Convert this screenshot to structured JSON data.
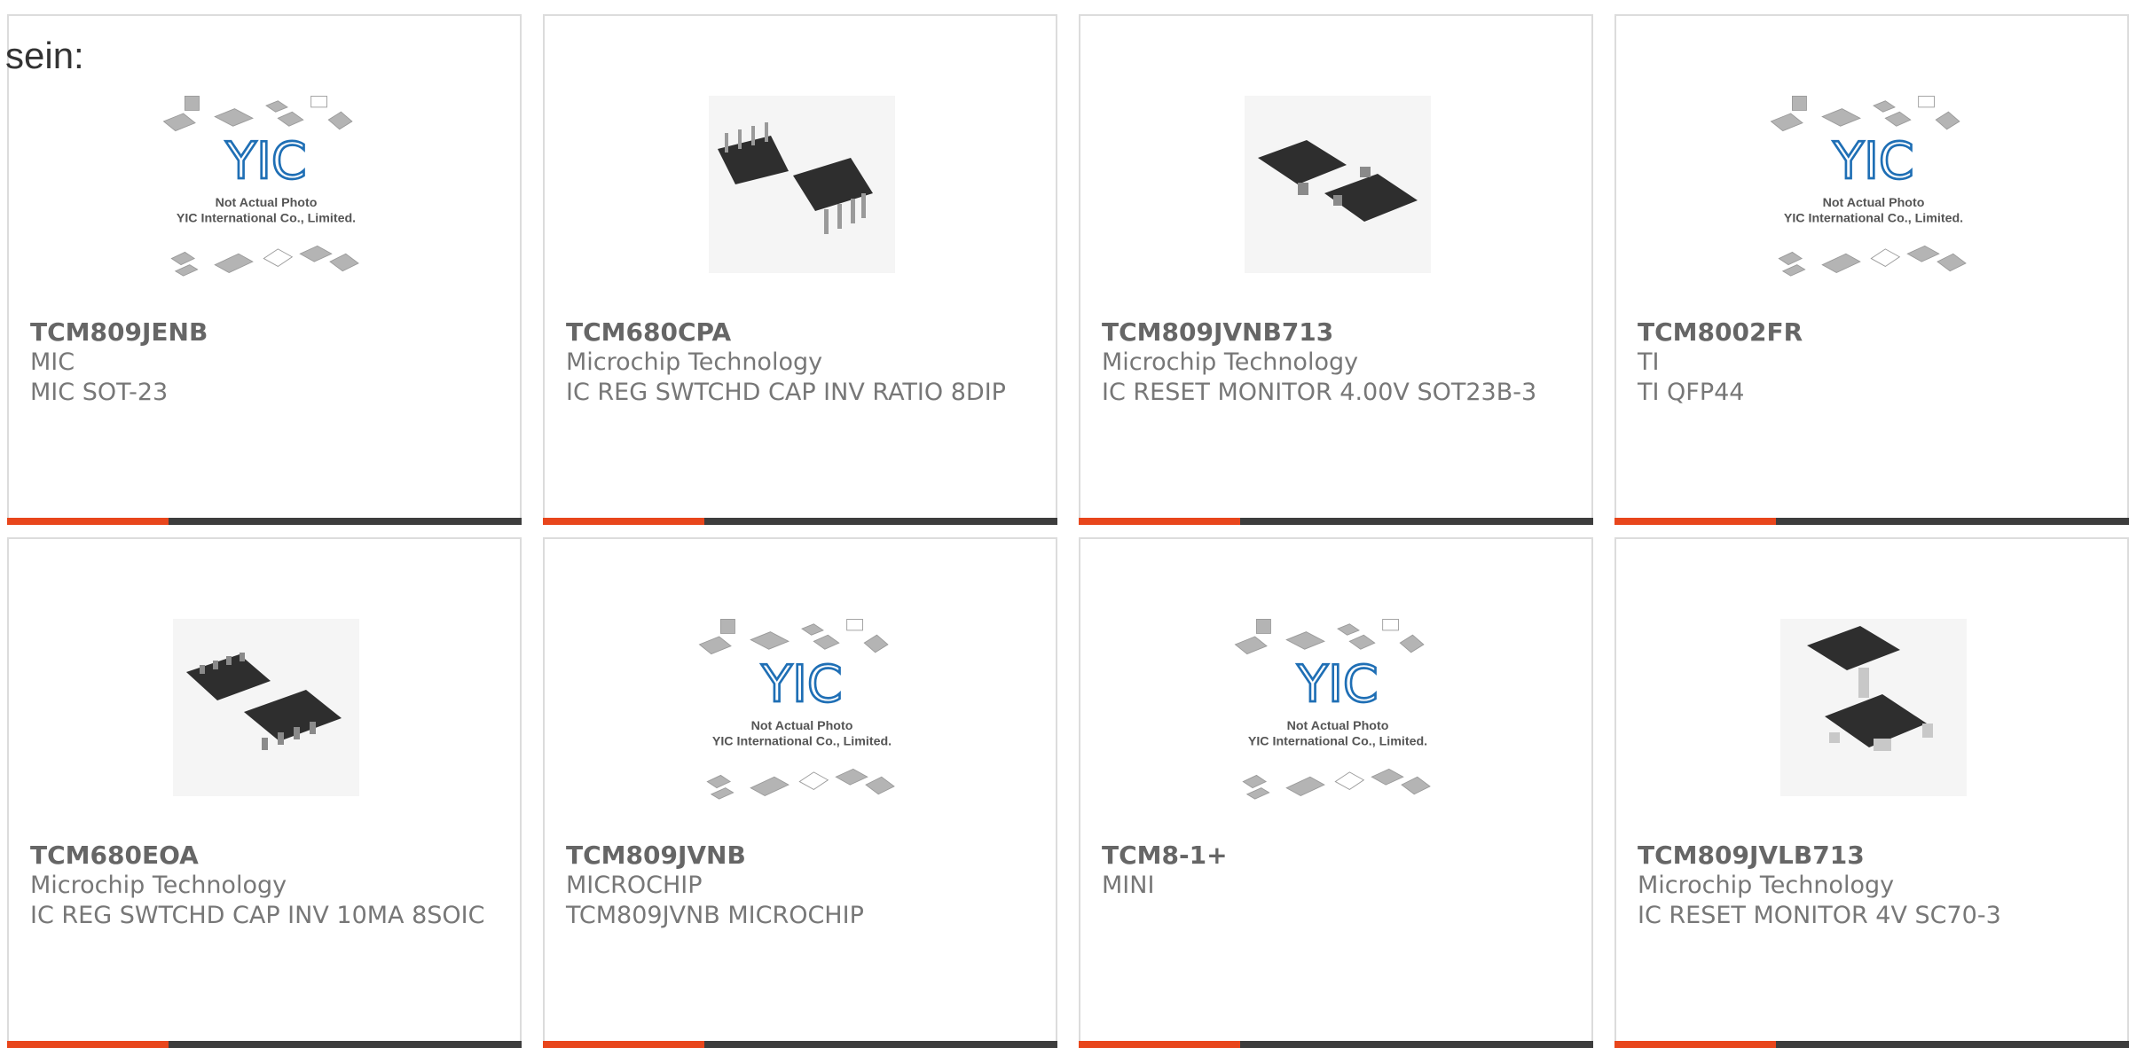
{
  "intro_text": "sein:",
  "placeholder": {
    "logo": "YIC",
    "caption_line1": "Not Actual Photo",
    "caption_line2": "YIC International Co., Limited."
  },
  "colors": {
    "accent": "#e8461c",
    "bar": "#3d3d3d",
    "border": "#dcdcdc",
    "logo_blue": "#1f6fb5"
  },
  "products": [
    {
      "pn": "TCM809JENB",
      "mfr": "MIC",
      "desc": "MIC SOT-23",
      "image": "not-actual-photo"
    },
    {
      "pn": "TCM680CPA",
      "mfr": "Microchip Technology",
      "desc": "IC REG SWTCHD CAP INV RATIO 8DIP",
      "image": "dip8-photo"
    },
    {
      "pn": "TCM809JVNB713",
      "mfr": "Microchip Technology",
      "desc": "IC RESET MONITOR 4.00V SOT23B-3",
      "image": "sot23-photo"
    },
    {
      "pn": "TCM8002FR",
      "mfr": "TI",
      "desc": "TI QFP44",
      "image": "not-actual-photo"
    },
    {
      "pn": "TCM680EOA",
      "mfr": "Microchip Technology",
      "desc": "IC REG SWTCHD CAP INV 10MA 8SOIC",
      "image": "soic8-photo"
    },
    {
      "pn": "TCM809JVNB",
      "mfr": "MICROCHIP",
      "desc": "TCM809JVNB MICROCHIP",
      "image": "not-actual-photo"
    },
    {
      "pn": "TCM8-1+",
      "mfr": "MINI",
      "desc": "",
      "image": "not-actual-photo"
    },
    {
      "pn": "TCM809JVLB713",
      "mfr": "Microchip Technology",
      "desc": "IC RESET MONITOR 4V SC70-3",
      "image": "sc70-photo"
    }
  ]
}
